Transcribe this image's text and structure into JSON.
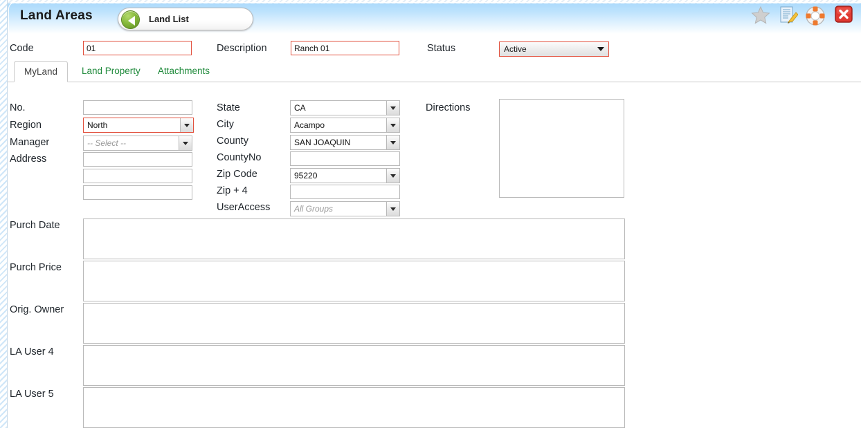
{
  "header": {
    "title": "Land Areas",
    "back_button_label": "Land List",
    "icons": [
      {
        "name": "star-icon",
        "label": "Favorite"
      },
      {
        "name": "notes-icon",
        "label": "Notes"
      },
      {
        "name": "help-icon",
        "label": "Help"
      },
      {
        "name": "close-icon",
        "label": "Close"
      }
    ]
  },
  "top_form": {
    "code_label": "Code",
    "code_value": "01",
    "description_label": "Description",
    "description_value": "Ranch 01",
    "status_label": "Status",
    "status_value": "Active"
  },
  "tabs": [
    {
      "label": "MyLand",
      "active": true
    },
    {
      "label": "Land Property",
      "active": false
    },
    {
      "label": "Attachments",
      "active": false
    }
  ],
  "left_column": {
    "no_label": "No.",
    "no_value": "",
    "region_label": "Region",
    "region_value": "North",
    "manager_label": "Manager",
    "manager_placeholder": "-- Select --",
    "manager_value": "",
    "address_label": "Address",
    "address_line1": "",
    "address_line2": "",
    "address_line3": ""
  },
  "middle_column": {
    "state_label": "State",
    "state_value": "CA",
    "city_label": "City",
    "city_value": "Acampo",
    "county_label": "County",
    "county_value": "SAN JOAQUIN",
    "countyno_label": "CountyNo",
    "countyno_value": "",
    "zipcode_label": "Zip Code",
    "zipcode_value": "95220",
    "zipplus4_label": "Zip + 4",
    "zipplus4_value": "",
    "useraccess_label": "UserAccess",
    "useraccess_placeholder": "All Groups",
    "useraccess_value": ""
  },
  "right_column": {
    "directions_label": "Directions",
    "directions_value": ""
  },
  "bottom_fields": [
    {
      "label": "Purch Date",
      "value": ""
    },
    {
      "label": "Purch Price",
      "value": ""
    },
    {
      "label": "Orig. Owner",
      "value": ""
    },
    {
      "label": "LA User 4",
      "value": ""
    },
    {
      "label": "LA User 5",
      "value": ""
    }
  ],
  "colors": {
    "header_blue": "#a4d6fb",
    "required_red": "#e2503d",
    "tab_green": "#1f8a3b",
    "close_red": "#e03a32",
    "back_green": "#87ba3c"
  }
}
